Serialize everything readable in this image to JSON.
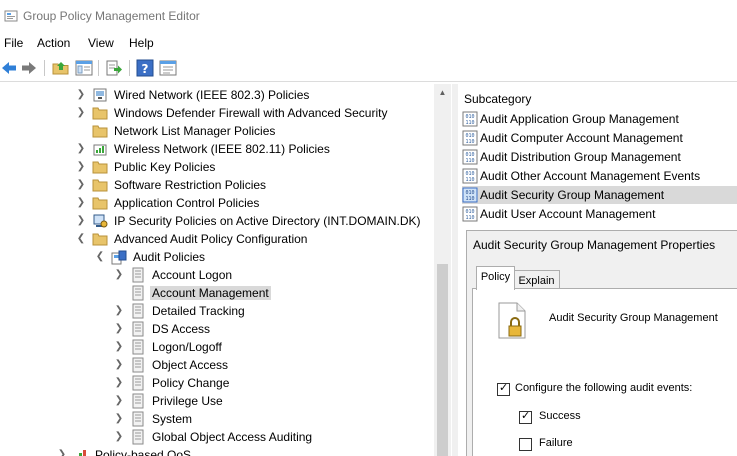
{
  "window": {
    "title": "Group Policy Management Editor"
  },
  "menu": [
    "File",
    "Action",
    "View",
    "Help"
  ],
  "toolbar": {
    "buttons": [
      "back-icon",
      "forward-icon",
      "up-folder-icon",
      "show-hide-tree-icon",
      "export-list-icon",
      "help-icon",
      "properties-icon"
    ]
  },
  "tree": [
    {
      "label": "Wired Network (IEEE 802.3) Policies",
      "icon": "network-policy-icon",
      "expander": "collapsed"
    },
    {
      "label": "Windows Defender Firewall with Advanced Security",
      "icon": "folder-icon",
      "expander": "collapsed"
    },
    {
      "label": "Network List Manager Policies",
      "icon": "folder-icon",
      "expander": "none"
    },
    {
      "label": "Wireless Network (IEEE 802.11) Policies",
      "icon": "wireless-policy-icon",
      "expander": "collapsed"
    },
    {
      "label": "Public Key Policies",
      "icon": "folder-icon",
      "expander": "collapsed"
    },
    {
      "label": "Software Restriction Policies",
      "icon": "folder-icon",
      "expander": "collapsed"
    },
    {
      "label": "Application Control Policies",
      "icon": "folder-icon",
      "expander": "collapsed"
    },
    {
      "label": "IP Security Policies on Active Directory (INT.DOMAIN.DK)",
      "icon": "ip-security-icon",
      "expander": "collapsed"
    },
    {
      "label": "Advanced Audit Policy Configuration",
      "icon": "folder-icon",
      "expander": "expanded"
    },
    {
      "label": "Audit Policies",
      "icon": "audit-policies-icon",
      "expander": "expanded"
    },
    {
      "label": "Account Logon",
      "icon": "notebook-icon",
      "expander": "collapsed"
    },
    {
      "label": "Account Management",
      "icon": "notebook-icon",
      "expander": "none",
      "selected": true
    },
    {
      "label": "Detailed Tracking",
      "icon": "notebook-icon",
      "expander": "collapsed"
    },
    {
      "label": "DS Access",
      "icon": "notebook-icon",
      "expander": "collapsed"
    },
    {
      "label": "Logon/Logoff",
      "icon": "notebook-icon",
      "expander": "collapsed"
    },
    {
      "label": "Object Access",
      "icon": "notebook-icon",
      "expander": "collapsed"
    },
    {
      "label": "Policy Change",
      "icon": "notebook-icon",
      "expander": "collapsed"
    },
    {
      "label": "Privilege Use",
      "icon": "notebook-icon",
      "expander": "collapsed"
    },
    {
      "label": "System",
      "icon": "notebook-icon",
      "expander": "collapsed"
    },
    {
      "label": "Global Object Access Auditing",
      "icon": "notebook-icon",
      "expander": "collapsed"
    },
    {
      "label": "Policy-based QoS",
      "icon": "qos-chart-icon",
      "expander": "collapsed"
    }
  ],
  "subcategory": {
    "header": "Subcategory",
    "items": [
      {
        "label": "Audit Application Group Management"
      },
      {
        "label": "Audit Computer Account Management"
      },
      {
        "label": "Audit Distribution Group Management"
      },
      {
        "label": "Audit Other Account Management Events"
      },
      {
        "label": "Audit Security Group Management",
        "selected": true
      },
      {
        "label": "Audit User Account Management"
      }
    ]
  },
  "properties": {
    "title": "Audit Security Group Management Properties",
    "tabs": [
      "Policy",
      "Explain"
    ],
    "active_tab": "Policy",
    "policy_name": "Audit Security Group Management",
    "configure_label": "Configure the following audit events:",
    "configure_checked": true,
    "success_label": "Success",
    "success_checked": true,
    "failure_label": "Failure",
    "failure_checked": false
  },
  "colors": {
    "selection": "#d9d9d9",
    "folder": "#e8c46a",
    "accent_blue": "#2f7fd7"
  }
}
